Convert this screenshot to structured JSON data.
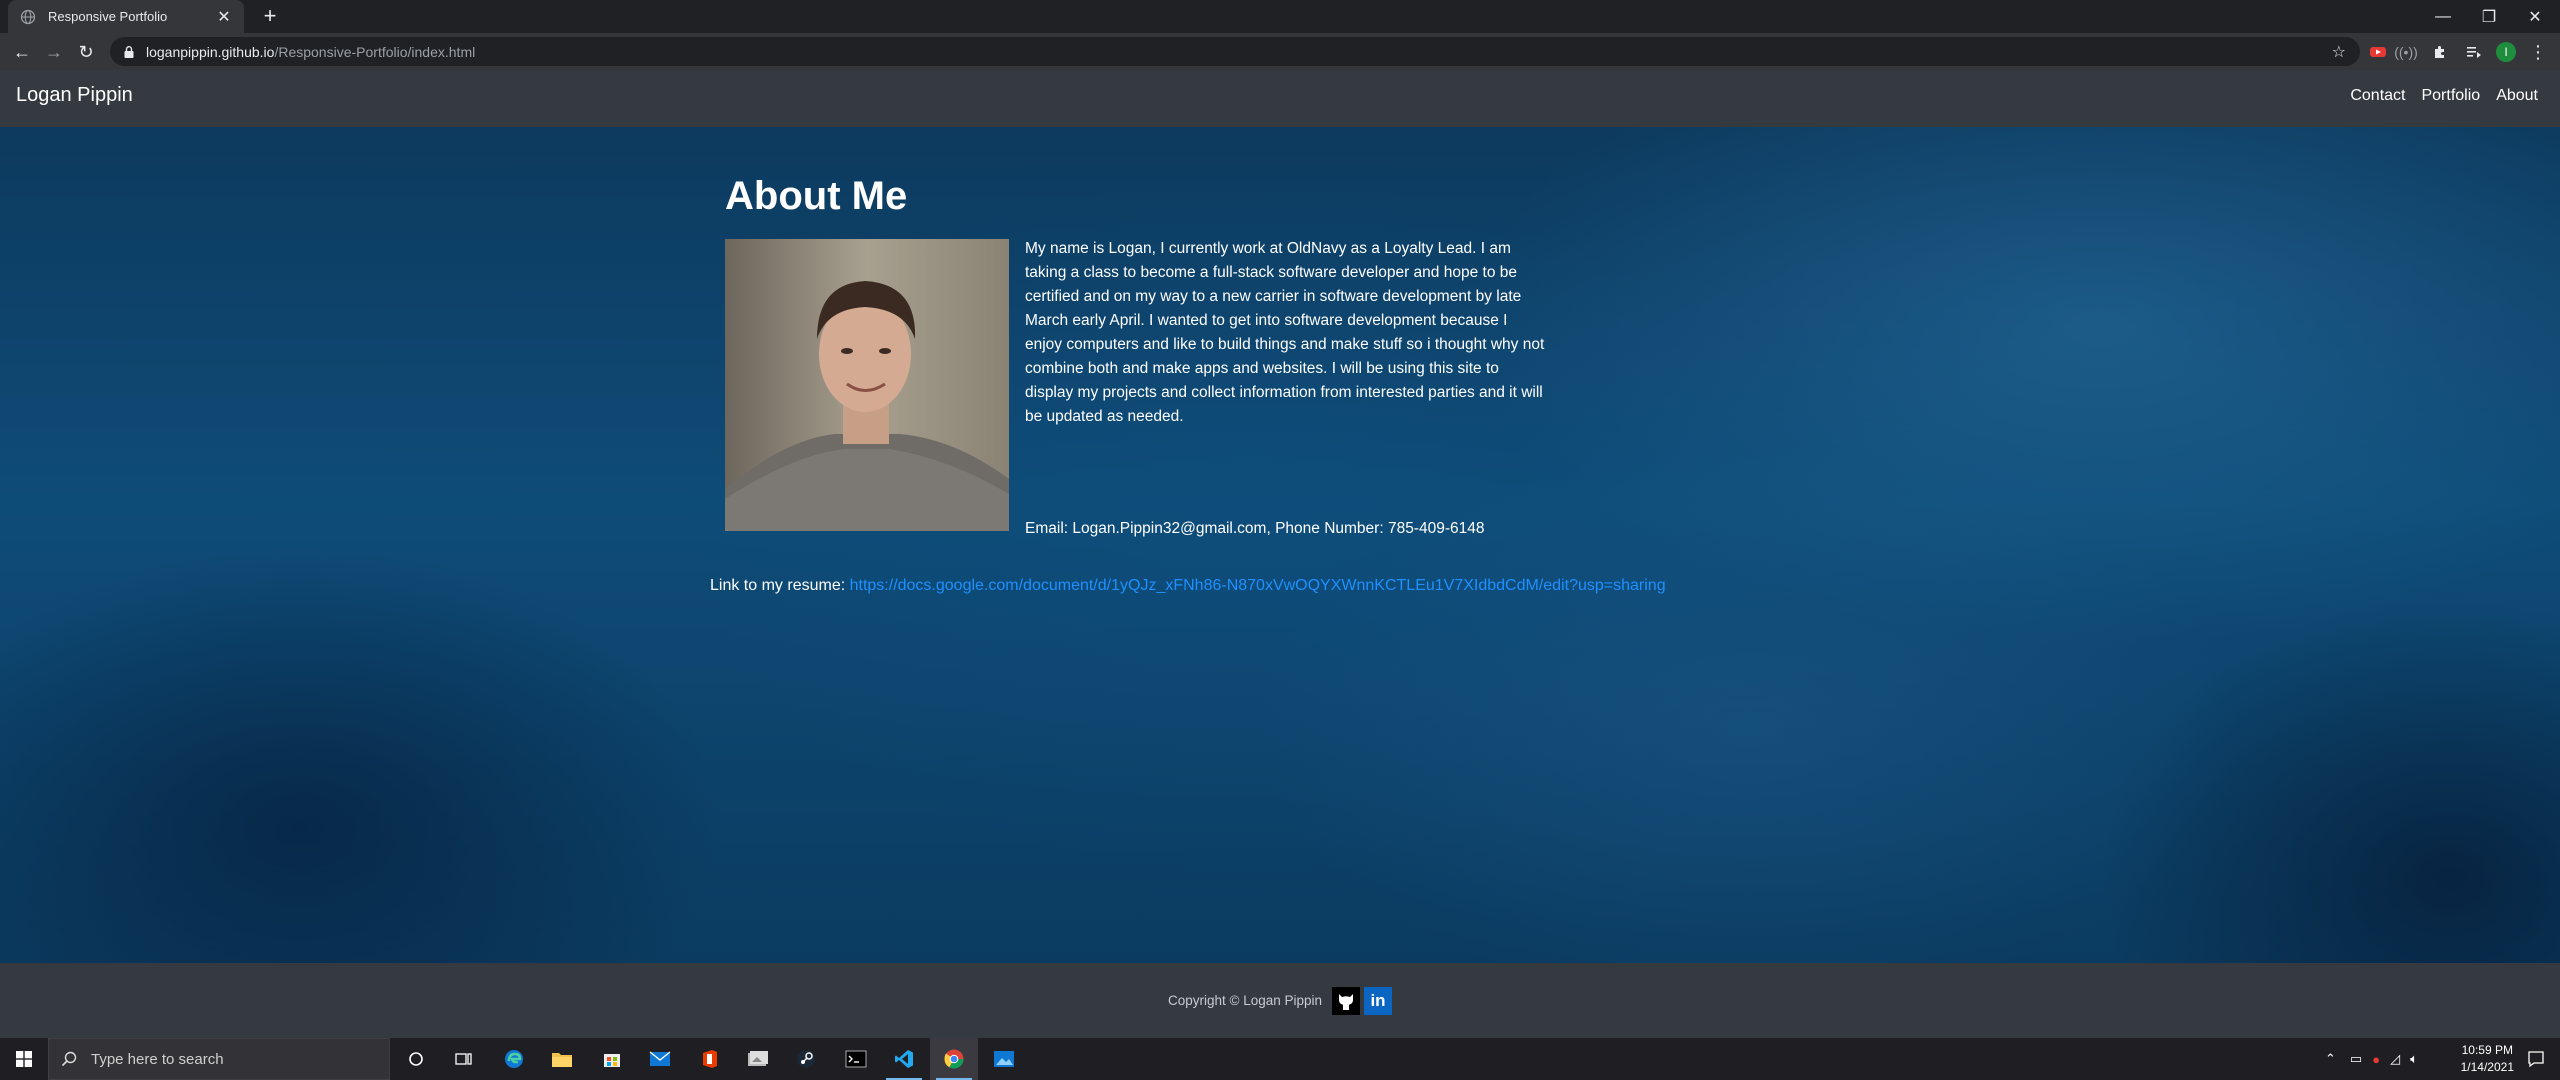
{
  "browser": {
    "tab_title": "Responsive Portfolio",
    "url_host": "loganpippin.github.io",
    "url_path": "/Responsive-Portfolio/index.html",
    "profile_initial": "I"
  },
  "site": {
    "brand": "Logan Pippin",
    "nav": [
      "Contact",
      "Portfolio",
      "About"
    ],
    "heading": "About Me",
    "bio": "My name is Logan, I currently work at OldNavy as a Loyalty Lead. I am taking a class to become a full-stack software developer and hope to be certified and on my way to a new carrier in software development by late March early April. I wanted to get into software development because I enjoy computers and like to build things and make stuff so i thought why not combine both and make apps and websites. I will be using this site to display my projects and collect information from interested parties and it will be updated as needed.",
    "contact": "Email: Logan.Pippin32@gmail.com, Phone Number: 785-409-6148",
    "resume_label": "Link to my resume: ",
    "resume_url": "https://docs.google.com/document/d/1yQJz_xFNh86-N870xVwOQYXWnnKCTLEu1V7XIdbdCdM/edit?usp=sharing",
    "footer_copyright": "Copyright © Logan Pippin",
    "linkedin_text": "in"
  },
  "taskbar": {
    "search_placeholder": "Type here to search",
    "time": "10:59 PM",
    "date": "1/14/2021"
  },
  "colors": {
    "nav_bg": "#343a40",
    "link": "#1e90ff",
    "hero_blue": "#0e4c78"
  }
}
